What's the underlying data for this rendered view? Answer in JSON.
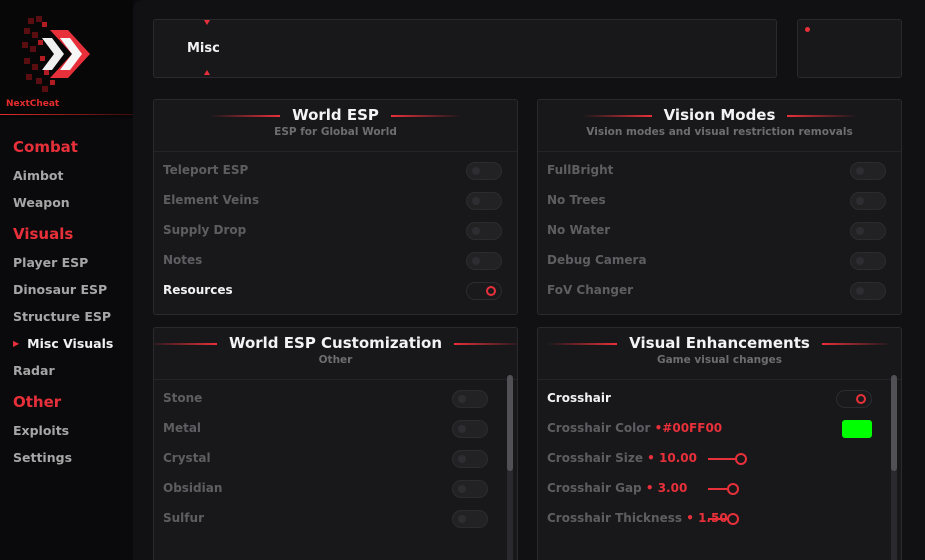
{
  "brand": {
    "name": "NextCheat",
    "accent": "#e8303a"
  },
  "sidebar": {
    "sections": [
      {
        "header": "Combat",
        "items": [
          {
            "label": "Aimbot"
          },
          {
            "label": "Weapon"
          }
        ]
      },
      {
        "header": "Visuals",
        "items": [
          {
            "label": "Player ESP"
          },
          {
            "label": "Dinosaur ESP"
          },
          {
            "label": "Structure ESP"
          },
          {
            "label": "Misc Visuals",
            "active": true
          },
          {
            "label": "Radar"
          }
        ]
      },
      {
        "header": "Other",
        "items": [
          {
            "label": "Exploits"
          },
          {
            "label": "Settings"
          }
        ]
      }
    ]
  },
  "top_tab": {
    "label": "Misc"
  },
  "panels": {
    "world_esp": {
      "title": "World ESP",
      "subtitle": "ESP for Global World",
      "options": [
        {
          "label": "Teleport ESP",
          "enabled": false
        },
        {
          "label": "Element Veins",
          "enabled": false
        },
        {
          "label": "Supply Drop",
          "enabled": false
        },
        {
          "label": "Notes",
          "enabled": false
        },
        {
          "label": "Resources",
          "enabled": true
        }
      ]
    },
    "vision_modes": {
      "title": "Vision Modes",
      "subtitle": "Vision modes and visual restriction removals",
      "options": [
        {
          "label": "FullBright",
          "enabled": false
        },
        {
          "label": "No Trees",
          "enabled": false
        },
        {
          "label": "No Water",
          "enabled": false
        },
        {
          "label": "Debug Camera",
          "enabled": false
        },
        {
          "label": "FoV Changer",
          "enabled": false
        }
      ]
    },
    "world_esp_custom": {
      "title": "World ESP Customization",
      "subtitle": "Other",
      "options": [
        {
          "label": "Stone",
          "enabled": false
        },
        {
          "label": "Metal",
          "enabled": false
        },
        {
          "label": "Crystal",
          "enabled": false
        },
        {
          "label": "Obsidian",
          "enabled": false
        },
        {
          "label": "Sulfur",
          "enabled": false
        }
      ]
    },
    "visual_enh": {
      "title": "Visual Enhancements",
      "subtitle": "Game visual changes",
      "crosshair": {
        "label": "Crosshair",
        "enabled": true
      },
      "color": {
        "label": "Crosshair Color",
        "bullet": "•",
        "value": "#00FF00",
        "swatch": "#00ff00"
      },
      "size": {
        "label": "Crosshair Size",
        "bullet": "•",
        "value": "10.00",
        "fill": 0.43
      },
      "gap": {
        "label": "Crosshair Gap",
        "bullet": "•",
        "value": "3.00",
        "fill": 0.3
      },
      "thickness": {
        "label": "Crosshair Thickness",
        "bullet": "•",
        "value": "1.50",
        "fill": 0.3
      }
    }
  }
}
